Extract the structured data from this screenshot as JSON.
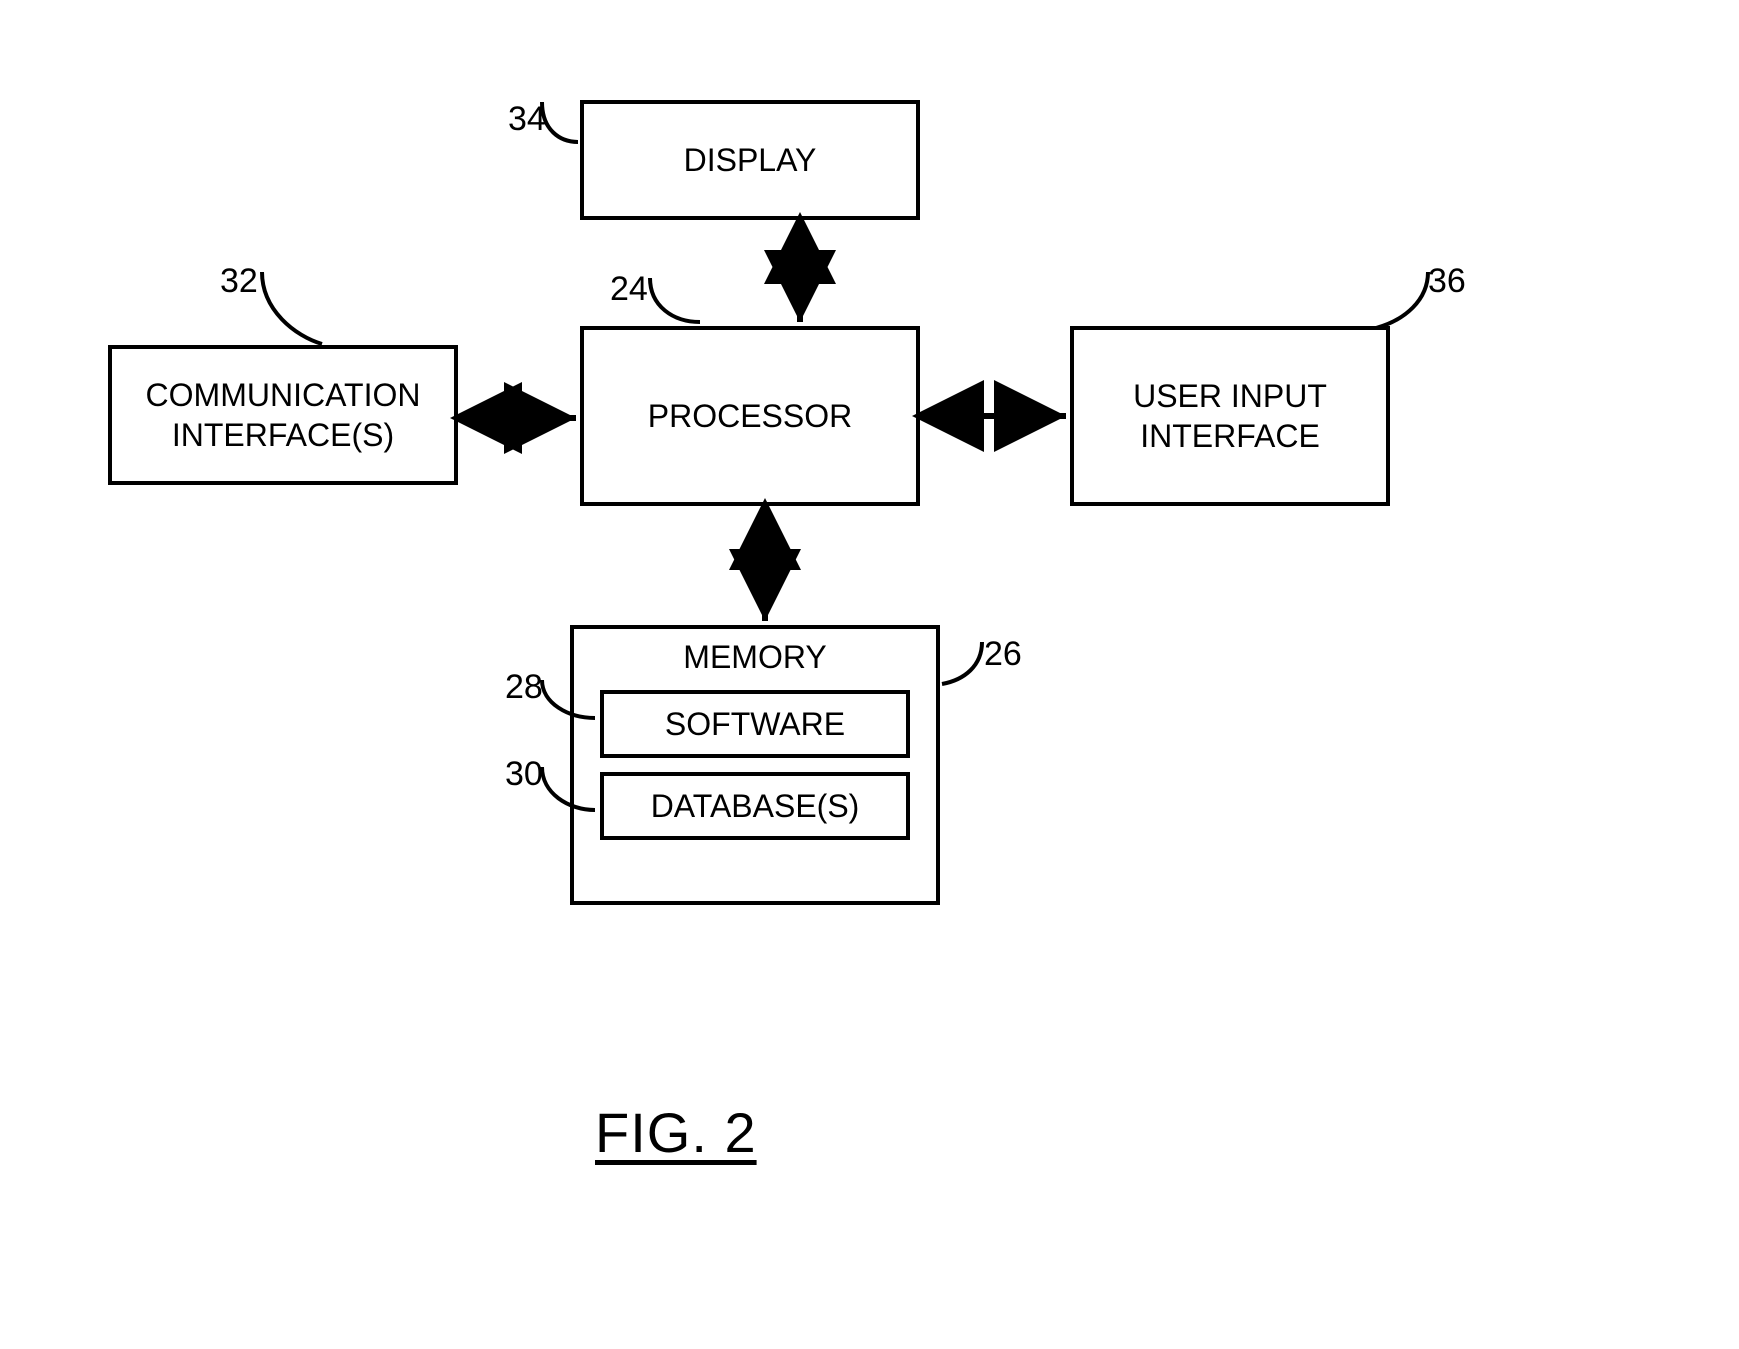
{
  "boxes": {
    "display": {
      "label": "DISPLAY",
      "ref": "34"
    },
    "processor": {
      "label": "PROCESSOR",
      "ref": "24"
    },
    "comm": {
      "label": "COMMUNICATION\nINTERFACE(S)",
      "ref": "32"
    },
    "userinput": {
      "label": "USER INPUT\nINTERFACE",
      "ref": "36"
    },
    "memory": {
      "label": "MEMORY",
      "ref": "26"
    },
    "software": {
      "label": "SOFTWARE",
      "ref": "28"
    },
    "database": {
      "label": "DATABASE(S)",
      "ref": "30"
    }
  },
  "figure_caption": "FIG. 2"
}
